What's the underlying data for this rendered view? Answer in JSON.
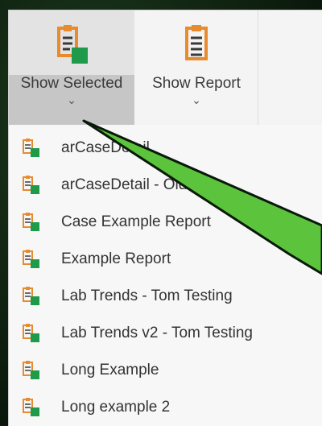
{
  "ribbon": {
    "show_selected": {
      "label": "Show Selected",
      "icon": "report-selected-icon"
    },
    "show_report": {
      "label": "Show Report",
      "icon": "report-icon"
    },
    "chevron": "⌄"
  },
  "menu": {
    "items": [
      {
        "label": "arCaseDetail"
      },
      {
        "label": "arCaseDetail - Old"
      },
      {
        "label": "Case Example Report"
      },
      {
        "label": "Example Report"
      },
      {
        "label": "Lab Trends - Tom Testing"
      },
      {
        "label": "Lab Trends v2 - Tom Testing"
      },
      {
        "label": "Long Example"
      },
      {
        "label": "Long example 2"
      }
    ]
  },
  "colors": {
    "accent_orange": "#e88a2e",
    "accent_green": "#1e9a4a",
    "arrow_green": "#5cc43c"
  }
}
